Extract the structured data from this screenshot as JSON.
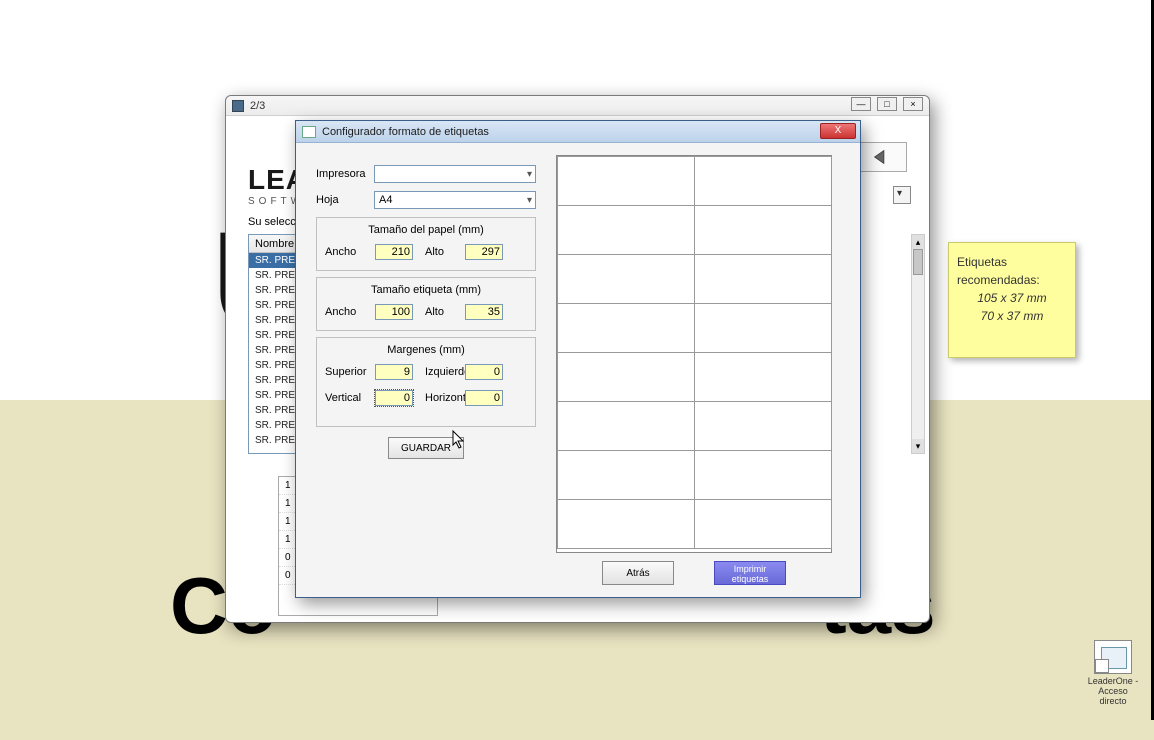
{
  "background": {
    "large_text_left": "Co",
    "large_text_right": "tas",
    "letter_u": "U"
  },
  "parent_window": {
    "title": "2/3",
    "logo_main": "LEA",
    "logo_sub": "SOFTWA",
    "selection_label": "Su selecció",
    "list_header": "Nombre",
    "list_rows": [
      "SR. PRESID",
      "SR. PRESID",
      "SR. PRESID",
      "SR. PRESID",
      "SR. PRESID",
      "SR. PRESID",
      "SR. PRESID",
      "SR. PRESID",
      "SR. PRESID",
      "SR. PRESID",
      "SR. PRESID",
      "SR. PRESID",
      "SR. PRESID"
    ],
    "lower_rows": [
      "1",
      "1",
      "1",
      "1",
      "0",
      "0"
    ]
  },
  "dialog": {
    "title": "Configurador formato de etiquetas",
    "close": "X",
    "printer_label": "Impresora",
    "printer_value": "",
    "sheet_label": "Hoja",
    "sheet_value": "A4",
    "paper_group": "Tamaño del papel (mm)",
    "label_group": "Tamaño etiqueta (mm)",
    "margin_group": "Margenes (mm)",
    "width_label": "Ancho",
    "height_label": "Alto",
    "paper_width": "210",
    "paper_height": "297",
    "label_width": "100",
    "label_height": "35",
    "margin_top_label": "Superior",
    "margin_left_label": "Izquierdo",
    "margin_vert_label": "Vertical",
    "margin_horiz_label": "Horizontal",
    "margin_top": "9",
    "margin_left": "0",
    "margin_vert": "0",
    "margin_horiz": "0",
    "save_label": "GUARDAR",
    "back_label": "Atrás",
    "print_label": "Imprimir etiquetas"
  },
  "sticky": {
    "line1": "Etiquetas",
    "line2": "recomendadas:",
    "dim1": "105 x 37 mm",
    "dim2": "70 x 37 mm"
  },
  "shortcut": {
    "label": "LeaderOne - Acceso directo"
  }
}
